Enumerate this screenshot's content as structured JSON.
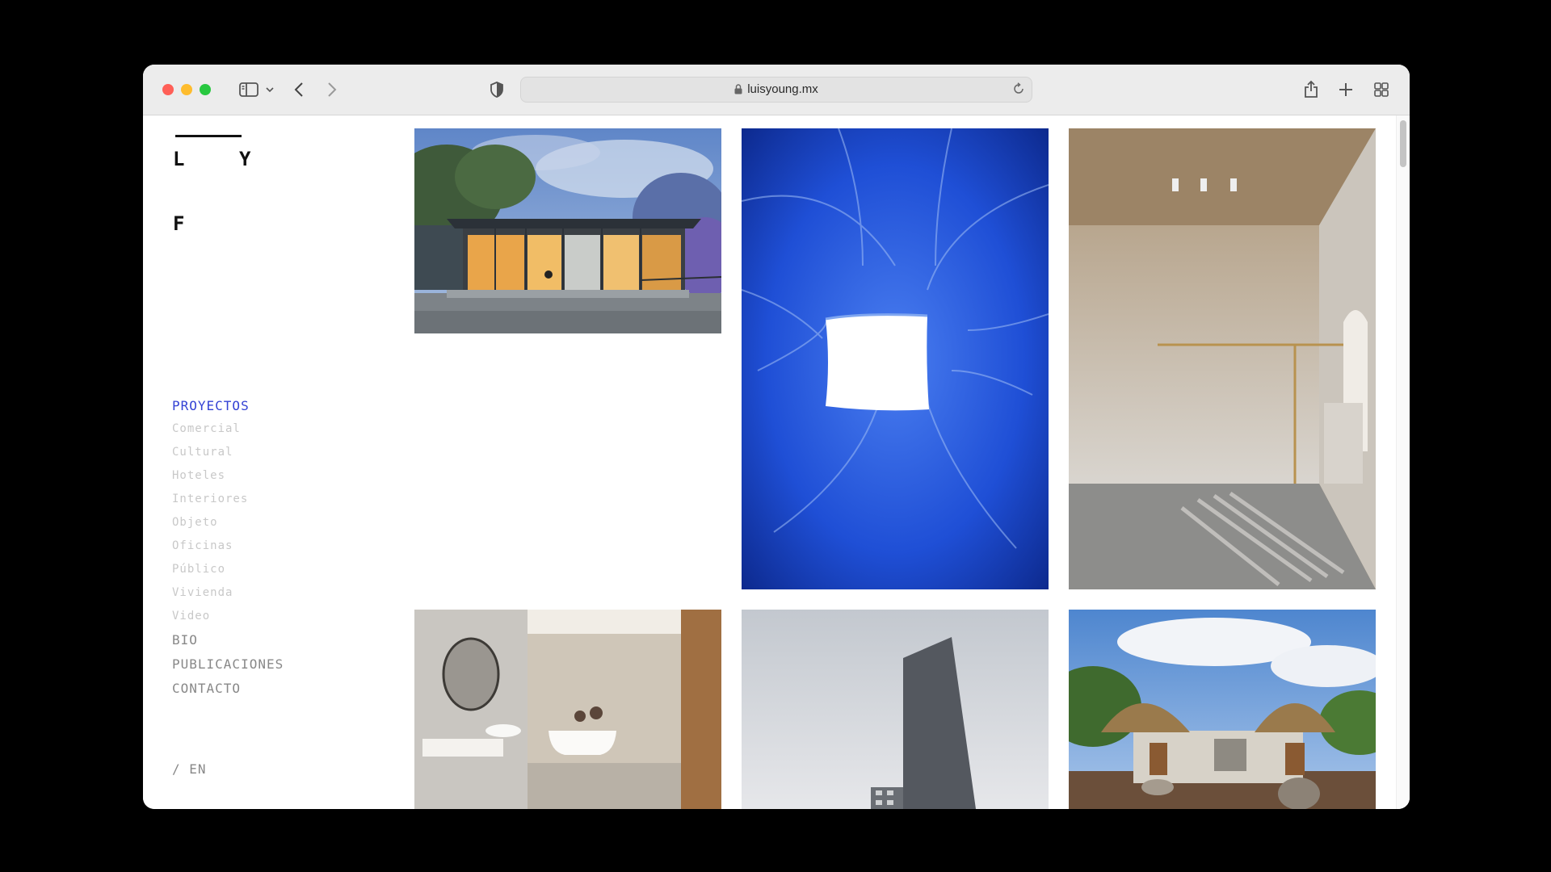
{
  "browser": {
    "url": "luisyoung.mx",
    "icons": [
      "sidebar-icon",
      "chevron-down-icon",
      "back-icon",
      "forward-icon",
      "shield-icon",
      "lock-icon",
      "reload-icon",
      "share-icon",
      "new-tab-icon",
      "tab-overview-icon"
    ]
  },
  "logo": {
    "l1": "L",
    "l2": "Y",
    "l3": "F"
  },
  "nav": {
    "proyectos": "PROYECTOS",
    "categories": [
      "Comercial",
      "Cultural",
      "Hoteles",
      "Interiores",
      "Objeto",
      "Oficinas",
      "Público",
      "Vivienda",
      "Video"
    ],
    "bio": "BIO",
    "publicaciones": "PUBLICACIONES",
    "contacto": "CONTACTO"
  },
  "lang": "/ EN",
  "colors": {
    "accent": "#3442d4",
    "muted": "#888888",
    "sub": "#c8c8c8"
  }
}
